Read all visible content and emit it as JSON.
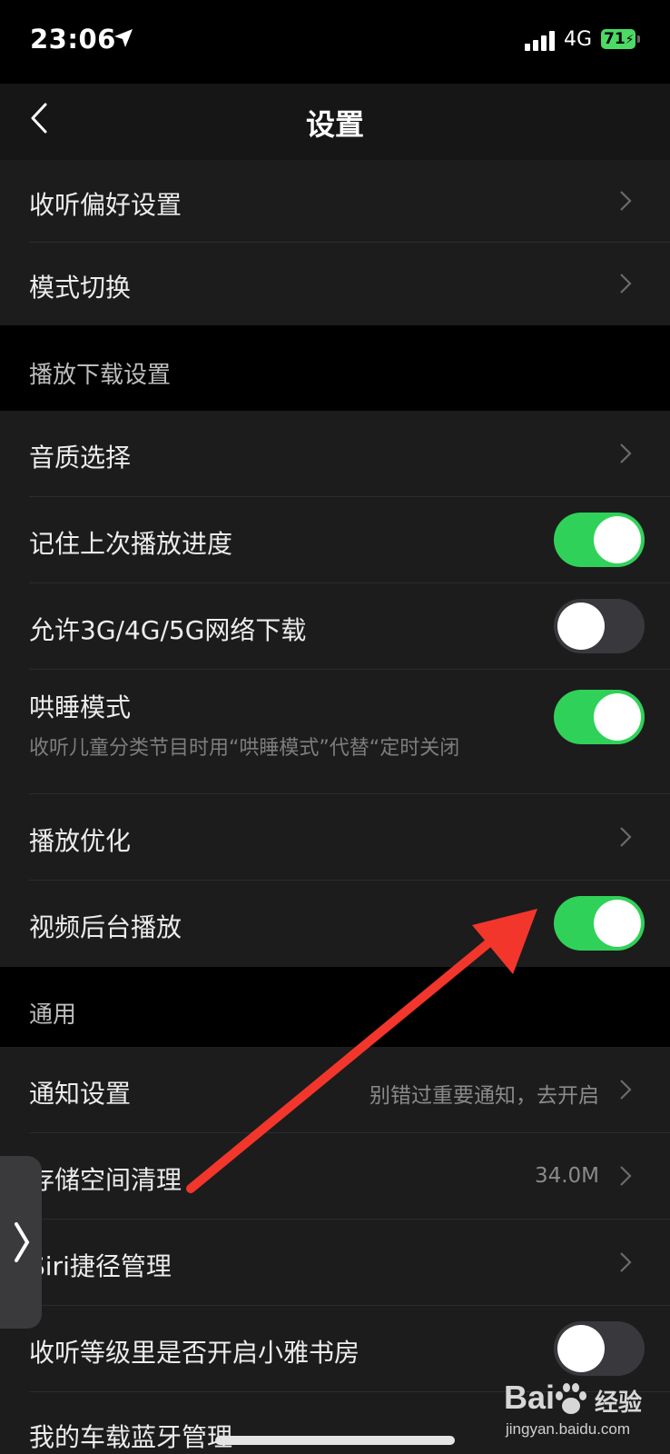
{
  "status_bar": {
    "time": "23:06",
    "network": "4G",
    "battery": "71"
  },
  "nav": {
    "title": "设置"
  },
  "group1": [
    {
      "label": "收听偏好设置"
    },
    {
      "label": "模式切换"
    }
  ],
  "section_play": {
    "header": "播放下载设置"
  },
  "play_rows": [
    {
      "label": "音质选择",
      "type": "chevron"
    },
    {
      "label": "记住上次播放进度",
      "type": "toggle",
      "on": true
    },
    {
      "label": "允许3G/4G/5G网络下载",
      "type": "toggle",
      "on": false
    },
    {
      "label": "哄睡模式",
      "sub": "收听儿童分类节目时用“哄睡模式”代替“定时关闭",
      "type": "toggle",
      "on": true
    },
    {
      "label": "播放优化",
      "type": "chevron"
    },
    {
      "label": "视频后台播放",
      "type": "toggle",
      "on": true
    }
  ],
  "section_general": {
    "header": "通用"
  },
  "general_rows": [
    {
      "label": "通知设置",
      "value": "别错过重要通知，去开启",
      "type": "chevron"
    },
    {
      "label": "存储空间清理",
      "value": "34.0M",
      "type": "chevron"
    },
    {
      "label": "Siri捷径管理",
      "type": "chevron"
    },
    {
      "label": "收听等级里是否开启小雅书房",
      "type": "toggle",
      "on": false
    },
    {
      "label": "我的车载蓝牙管理",
      "type": "chevron"
    }
  ],
  "watermark": {
    "brand": "Bai",
    "brand2": "经验",
    "url": "jingyan.baidu.com"
  },
  "colors": {
    "toggle_on": "#30d158",
    "toggle_off": "#39393d",
    "annotation_arrow": "#f2362c"
  }
}
